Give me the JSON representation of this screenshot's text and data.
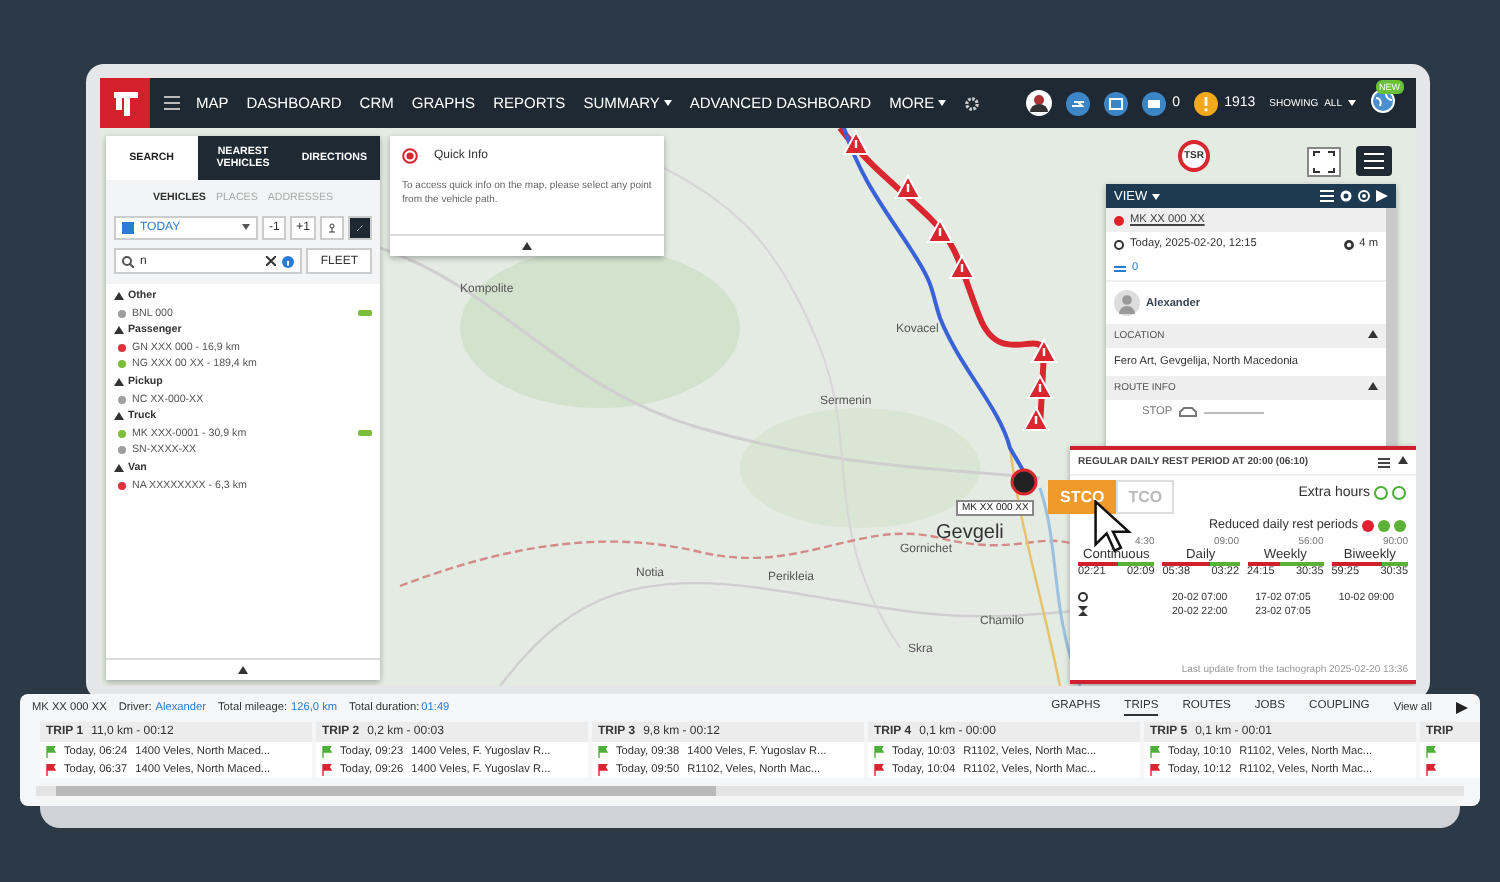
{
  "top_bar": {
    "nav": [
      {
        "label": "MAP",
        "dropdown": false
      },
      {
        "label": "DASHBOARD",
        "dropdown": false
      },
      {
        "label": "CRM",
        "dropdown": false
      },
      {
        "label": "GRAPHS",
        "dropdown": false
      },
      {
        "label": "REPORTS",
        "dropdown": false
      },
      {
        "label": "SUMMARY",
        "dropdown": true
      },
      {
        "label": "ADVANCED DASHBOARD",
        "dropdown": false
      },
      {
        "label": "MORE",
        "dropdown": true
      }
    ],
    "mail_count": "0",
    "alert_count": "1913",
    "showing_label": "SHOWING",
    "showing_value": "ALL",
    "new_badge": "NEW"
  },
  "search_panel": {
    "tabs": [
      {
        "label": "SEARCH",
        "selected": true
      },
      {
        "label": "NEAREST VEHICLES",
        "selected": false
      },
      {
        "label": "DIRECTIONS",
        "selected": false
      }
    ],
    "subtabs": [
      {
        "label": "VEHICLES",
        "selected": true
      },
      {
        "label": "PLACES",
        "selected": false
      },
      {
        "label": "ADDRESSES",
        "selected": false
      }
    ],
    "date": "TODAY",
    "prev": "-1",
    "next": "+1",
    "search_value": "n",
    "fleet_button": "FLEET",
    "groups": [
      {
        "label": "Other",
        "expanded": true,
        "children": [
          {
            "label": "BNL 000",
            "color": "#9e9e9e",
            "signal": true
          }
        ]
      },
      {
        "label": "Passenger",
        "expanded": true,
        "children": [
          {
            "label": "GN XXX 000 - 16,9 km",
            "color": "#e0303a",
            "signal": false
          },
          {
            "label": "NG XXX 00 XX - 189,4 km",
            "color": "#7cbd3a",
            "signal": false
          }
        ]
      },
      {
        "label": "Pickup",
        "expanded": true,
        "children": [
          {
            "label": "NC XX-000-XX",
            "color": "#9e9e9e",
            "signal": false
          }
        ]
      },
      {
        "label": "Truck",
        "expanded": true,
        "children": [
          {
            "label": "MK XXX-0001 - 30,9 km",
            "color": "#7cbd3a",
            "signal": true
          },
          {
            "label": "SN-XXXX-XX",
            "color": "#9e9e9e",
            "signal": false
          }
        ]
      },
      {
        "label": "Van",
        "expanded": true,
        "children": [
          {
            "label": "NA XXXXXXXX - 6,3 km",
            "color": "#e0303a",
            "signal": false
          }
        ]
      }
    ]
  },
  "quick_info": {
    "title": "Quick Info",
    "text": "To access quick info on the map, please select any point from the vehicle path."
  },
  "map": {
    "labels": [
      "Kompolite",
      "Kovacel",
      "Sermenin",
      "Gornichet",
      "Notia",
      "Perikleia",
      "Chamilo",
      "Skra",
      "Gevgeli"
    ],
    "sign": "TSR",
    "vehicle_label": "MK XX 000 XX"
  },
  "view_panel": {
    "title": "VIEW",
    "vehicle": {
      "label": "MK XX 000 XX",
      "color": "#e0202a"
    },
    "timestamp": "Today, 2025-02-20, 12:15",
    "duration": "4 m",
    "transfers": "0",
    "driver": "Alexander",
    "sections": [
      {
        "title": "LOCATION",
        "expanded": true,
        "kind": "text",
        "text": "Fero Art, Gevgelija, North Macedonia"
      },
      {
        "title": "ROUTE INFO",
        "expanded": true,
        "kind": "route",
        "text": "STOP"
      }
    ]
  },
  "tachograph": {
    "title": "REGULAR DAILY REST PERIOD AT 20:00 (06:10)",
    "tabs": [
      {
        "label": "STCO",
        "selected": true
      },
      {
        "label": "TCO",
        "selected": false
      }
    ],
    "extra_hours": {
      "label": "Extra hours",
      "indicators": [
        {
          "color": "#4caf3a"
        },
        {
          "color": "#4caf3a"
        }
      ]
    },
    "reduced_rest": {
      "label": "Reduced daily rest periods",
      "dots": [
        {
          "color": "#e02030"
        },
        {
          "color": "#5cb036"
        },
        {
          "color": "#5cb036"
        }
      ]
    },
    "periods": [
      {
        "label": "Continuous",
        "limit": "4:30",
        "used": "02:21",
        "left": "02:09",
        "level": 0.52
      },
      {
        "label": "Daily",
        "limit": "09:00",
        "used": "05:38",
        "left": "03:22",
        "level": 0.63
      },
      {
        "label": "Weekly",
        "limit": "56:00",
        "used": "24:15",
        "left": "30:35",
        "level": 0.43
      },
      {
        "label": "Biweekly",
        "limit": "90:00",
        "used": "59:25",
        "left": "30:35",
        "level": 0.66
      }
    ],
    "start_row": [
      "20-02 07:00",
      "17-02 07:05",
      "10-02 09:00"
    ],
    "end_row": [
      "20-02 22:00",
      "23-02 07:05"
    ],
    "footer": "Last update from the tachograph 2025-02-20 13:36"
  },
  "trips_panel": {
    "vehicle": "MK XX 000 XX",
    "driver_label": "Driver:",
    "driver": "Alexander",
    "mileage_label": "Total mileage:",
    "mileage": "126,0 km",
    "duration_label": "Total duration:",
    "duration": "01:49",
    "tabs": [
      {
        "label": "GRAPHS",
        "selected": false
      },
      {
        "label": "TRIPS",
        "selected": true
      },
      {
        "label": "ROUTES",
        "selected": false
      },
      {
        "label": "JOBS",
        "selected": false
      },
      {
        "label": "COUPLING",
        "selected": false
      }
    ],
    "view_all": "View all",
    "trips": [
      {
        "title": "TRIP 1",
        "summary": "11,0 km - 00:12",
        "start": {
          "time": "Today, 06:24",
          "place": "1400 Veles, North Maced..."
        },
        "end": {
          "time": "Today, 06:37",
          "place": "1400 Veles, North Maced..."
        }
      },
      {
        "title": "TRIP 2",
        "summary": "0,2 km - 00:03",
        "start": {
          "time": "Today, 09:23",
          "place": "1400 Veles, F. Yugoslav R..."
        },
        "end": {
          "time": "Today, 09:26",
          "place": "1400 Veles, F. Yugoslav R..."
        }
      },
      {
        "title": "TRIP 3",
        "summary": "9,8 km - 00:12",
        "start": {
          "time": "Today, 09:38",
          "place": "1400 Veles, F. Yugoslav R..."
        },
        "end": {
          "time": "Today, 09:50",
          "place": "R1102, Veles, North Mac..."
        }
      },
      {
        "title": "TRIP 4",
        "summary": "0,1 km - 00:00",
        "start": {
          "time": "Today, 10:03",
          "place": "R1102, Veles, North Mac..."
        },
        "end": {
          "time": "Today, 10:04",
          "place": "R1102, Veles, North Mac..."
        }
      },
      {
        "title": "TRIP 5",
        "summary": "0,1 km - 00:01",
        "start": {
          "time": "Today, 10:10",
          "place": "R1102, Veles, North Mac..."
        },
        "end": {
          "time": "Today, 10:12",
          "place": "R1102, Veles, North Mac..."
        }
      },
      {
        "title": "TRIP"
      }
    ]
  }
}
